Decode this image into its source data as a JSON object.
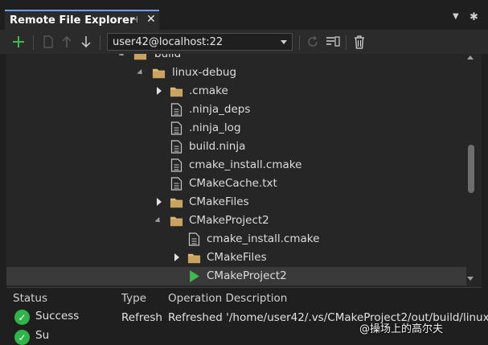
{
  "window": {
    "title": "Remote File Explorer",
    "pin_glyph": "⊣",
    "close_glyph": "✕"
  },
  "toolbar": {
    "host": "user42@localhost:22",
    "buttons": [
      "add-icon",
      "new-file-icon",
      "upload-icon",
      "download-icon",
      "refresh-icon",
      "terminal-icon",
      "delete-icon"
    ]
  },
  "tree": {
    "partial_top": "build",
    "items": [
      {
        "label": "linux-debug",
        "type": "folder",
        "expanded": true
      },
      {
        "label": ".cmake",
        "type": "folder",
        "expanded": false
      },
      {
        "label": ".ninja_deps",
        "type": "file"
      },
      {
        "label": ".ninja_log",
        "type": "file"
      },
      {
        "label": "build.ninja",
        "type": "file"
      },
      {
        "label": "cmake_install.cmake",
        "type": "file"
      },
      {
        "label": "CMakeCache.txt",
        "type": "file"
      },
      {
        "label": "CMakeFiles",
        "type": "folder",
        "expanded": false
      },
      {
        "label": "CMakeProject2",
        "type": "folder",
        "expanded": true
      },
      {
        "label": "cmake_install.cmake",
        "type": "file"
      },
      {
        "label": "CMakeFiles",
        "type": "folder",
        "expanded": false
      },
      {
        "label": "CMakeProject2",
        "type": "executable",
        "selected": true
      }
    ]
  },
  "status": {
    "headers": {
      "status": "Status",
      "type": "Type",
      "description": "Operation Description"
    },
    "rows": [
      {
        "status": "Success",
        "type": "Refresh",
        "description": "Refreshed '/home/user42/.vs/CMakeProject2/out/build/linux-"
      }
    ],
    "partial_second_row_status": "Su"
  },
  "watermark": "@操场上的高尔夫",
  "colors": {
    "accent": "#6b9bff",
    "folder": "#dcb67a",
    "success": "#2fb34a",
    "add": "#3fb950",
    "run": "#3fb950"
  }
}
